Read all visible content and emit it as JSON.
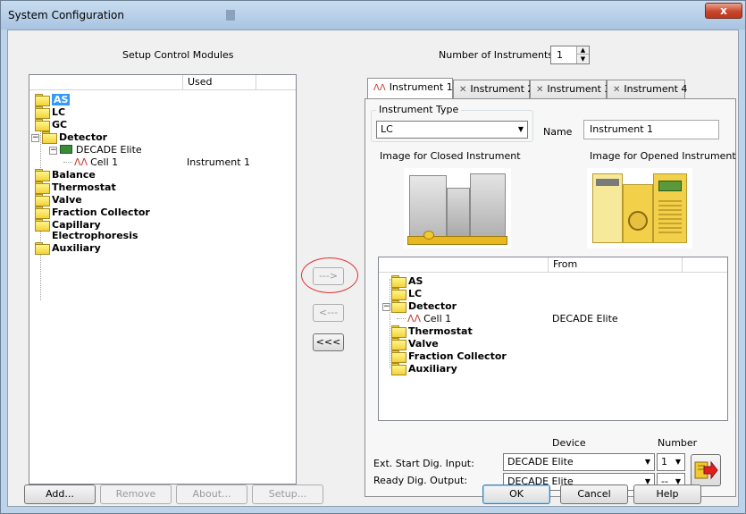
{
  "window": {
    "title": "System Configuration",
    "close_glyph": "x"
  },
  "left": {
    "heading": "Setup Control Modules",
    "col_used": "Used",
    "tree": [
      {
        "label": "AS",
        "selected": true
      },
      {
        "label": "LC"
      },
      {
        "label": "GC"
      },
      {
        "label": "Detector"
      },
      {
        "label": "DECADE Elite"
      },
      {
        "label": "Cell 1",
        "used": "Instrument 1"
      },
      {
        "label": "Balance"
      },
      {
        "label": "Thermostat"
      },
      {
        "label": "Valve"
      },
      {
        "label": "Fraction Collector"
      },
      {
        "label": "Capillary"
      },
      {
        "label": "Electrophoresis"
      },
      {
        "label": "Auxiliary"
      }
    ]
  },
  "middle": {
    "add_arrow": "--->",
    "remove_arrow": "<---",
    "remove_all_arrow": "<<<"
  },
  "right": {
    "num_instruments_label": "Number of Instruments:",
    "num_instruments_value": "1",
    "tabs": [
      {
        "label": "Instrument 1"
      },
      {
        "label": "Instrument 2"
      },
      {
        "label": "Instrument 3"
      },
      {
        "label": "Instrument 4"
      }
    ],
    "instrument_type_label": "Instrument Type",
    "instrument_type_value": "LC",
    "name_label": "Name",
    "name_value": "Instrument 1",
    "closed_image_label": "Image for Closed Instrument",
    "opened_image_label": "Image for Opened Instrument",
    "col_from": "From",
    "tree": [
      {
        "label": "AS"
      },
      {
        "label": "LC"
      },
      {
        "label": "Detector"
      },
      {
        "label": "Cell 1",
        "from": "DECADE Elite"
      },
      {
        "label": "Thermostat"
      },
      {
        "label": "Valve"
      },
      {
        "label": "Fraction Collector"
      },
      {
        "label": "Auxiliary"
      }
    ],
    "device_header": "Device",
    "number_header": "Number",
    "ext_start_label": "Ext. Start Dig. Input:",
    "ext_start_device": "DECADE Elite",
    "ext_start_number": "1",
    "ready_label": "Ready Dig. Output:",
    "ready_device": "DECADE Elite",
    "ready_number": "--"
  },
  "footer": {
    "add": "Add...",
    "remove": "Remove",
    "about": "About...",
    "setup": "Setup...",
    "ok": "OK",
    "cancel": "Cancel",
    "help": "Help"
  },
  "colors": {
    "selection": "#3399ff",
    "highlight_circle": "#e03030",
    "folder": "#f3d23c"
  }
}
